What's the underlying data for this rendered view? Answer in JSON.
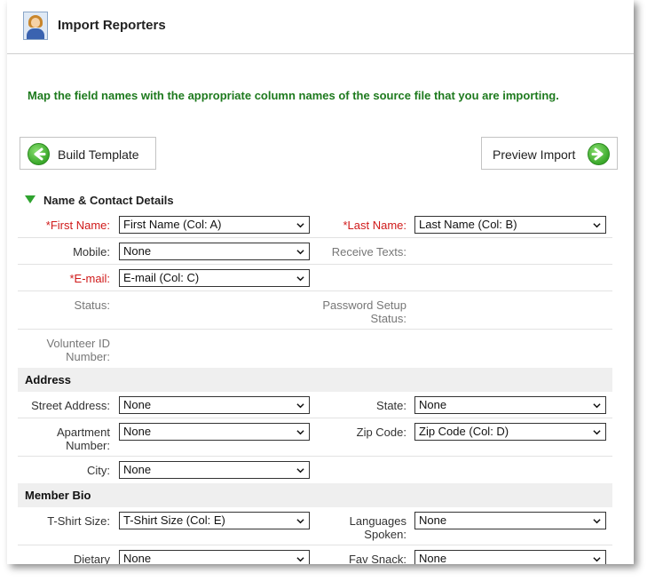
{
  "header": {
    "title": "Import Reporters"
  },
  "intro": "Map the field names with the appropriate column names of the source file that you are importing.",
  "nav": {
    "back_label": "Build Template",
    "forward_label": "Preview Import"
  },
  "sections": {
    "contact": {
      "title": "Name & Contact Details",
      "first_name_label": "*First Name:",
      "first_name_value": "First Name (Col: A)",
      "last_name_label": "*Last Name:",
      "last_name_value": "Last Name (Col: B)",
      "mobile_label": "Mobile:",
      "mobile_value": "None",
      "receive_texts_label": "Receive Texts:",
      "email_label": "*E-mail:",
      "email_value": "E-mail (Col: C)",
      "status_label": "Status:",
      "password_setup_label_1": "Password Setup",
      "password_setup_label_2": "Status:",
      "volunteer_id_label_1": "Volunteer ID",
      "volunteer_id_label_2": "Number:"
    },
    "address": {
      "title": "Address",
      "street_label": "Street Address:",
      "street_value": "None",
      "state_label": "State:",
      "state_value": "None",
      "apartment_label_1": "Apartment",
      "apartment_label_2": "Number:",
      "apartment_value": "None",
      "zip_label": "Zip Code:",
      "zip_value": "Zip Code (Col: D)",
      "city_label": "City:",
      "city_value": "None"
    },
    "bio": {
      "title": "Member Bio",
      "tshirt_label": "T-Shirt Size:",
      "tshirt_value": "T-Shirt Size (Col: E)",
      "languages_label_1": "Languages",
      "languages_label_2": "Spoken:",
      "languages_value": "None",
      "dietary_label": "Dietary",
      "dietary_value": "None",
      "fav_snack_label": "Fav Snack:",
      "fav_snack_value": "None"
    }
  }
}
